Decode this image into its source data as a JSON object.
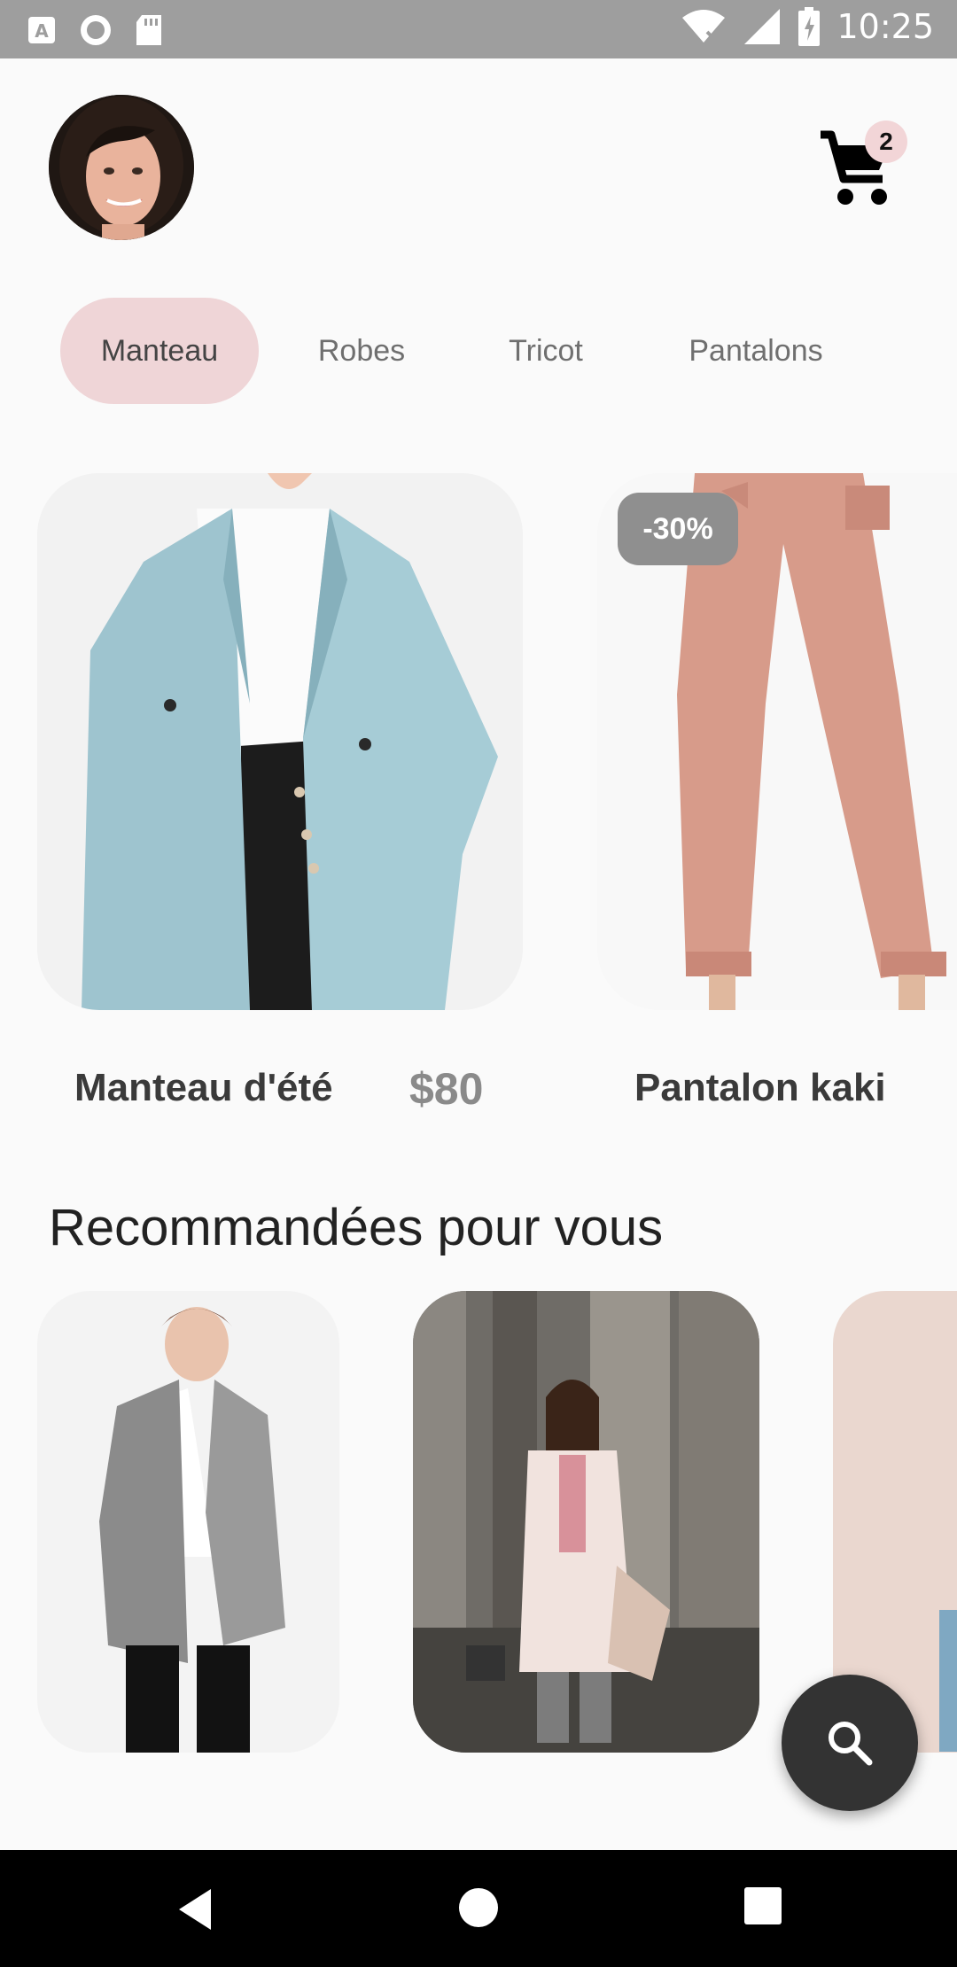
{
  "status_bar": {
    "time": "10:25",
    "left_icons": [
      "text-notification-icon",
      "circle-notification-icon",
      "sd-card-icon"
    ],
    "right_icons": [
      "wifi-icon",
      "signal-icon",
      "battery-icon"
    ]
  },
  "header": {
    "avatar_icon": "profile-avatar",
    "cart_icon": "shopping-cart-icon",
    "cart_count": "2"
  },
  "tabs": [
    {
      "label": "Manteau",
      "active": true
    },
    {
      "label": "Robes",
      "active": false
    },
    {
      "label": "Tricot",
      "active": false
    },
    {
      "label": "Pantalons",
      "active": false
    }
  ],
  "featured": [
    {
      "name": "Manteau d'été",
      "price": "$80",
      "image": "blue-coat-photo"
    },
    {
      "name": "Pantalon kaki",
      "price": "",
      "badge": "-30%",
      "image": "pink-pants-photo"
    }
  ],
  "recommendations": {
    "title": "Recommandées pour vous",
    "items": [
      {
        "image": "plaid-blazer-photo"
      },
      {
        "image": "pink-coat-street-photo"
      },
      {
        "image": "beige-outfit-photo"
      }
    ]
  },
  "fab": {
    "icon": "search-icon"
  },
  "nav": {
    "icons": [
      "back-icon",
      "home-icon",
      "recents-icon"
    ]
  },
  "colors": {
    "accent_pink": "#efd5d7",
    "badge_gray": "#8f8f8f",
    "fab_dark": "#333333",
    "status_gray": "#9e9e9e"
  }
}
